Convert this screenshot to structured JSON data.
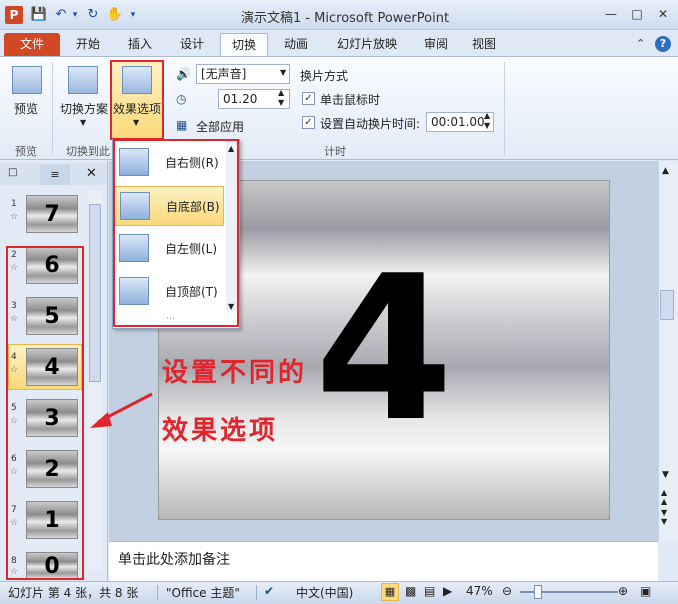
{
  "window": {
    "title": "演示文稿1 - Microsoft PowerPoint",
    "app_icon_letter": "P"
  },
  "quick_access": {
    "save_icon": "save-icon",
    "undo_icon": "undo-icon",
    "redo_icon": "redo-icon",
    "touch_icon": "touch-icon"
  },
  "tabs": [
    "文件",
    "开始",
    "插入",
    "设计",
    "切换",
    "动画",
    "幻灯片放映",
    "审阅",
    "视图"
  ],
  "active_tab": "切换",
  "ribbon": {
    "preview_label": "预览",
    "transition_scheme_label": "切换方案",
    "effect_options_label": "效果选项",
    "group_preview": "预览",
    "group_transition": "切换到此",
    "sound_value": "[无声音]",
    "duration_value": "01.20",
    "apply_all_label": "全部应用",
    "advance_heading": "换片方式",
    "on_click_label": "单击鼠标时",
    "on_click_checked": true,
    "after_label": "设置自动换片时间:",
    "after_checked": true,
    "after_value": "00:01.00",
    "timing_group": "计时"
  },
  "slides": [
    {
      "num": "1",
      "digit": "7"
    },
    {
      "num": "2",
      "digit": "6"
    },
    {
      "num": "3",
      "digit": "5"
    },
    {
      "num": "4",
      "digit": "4",
      "selected": true
    },
    {
      "num": "5",
      "digit": "3"
    },
    {
      "num": "6",
      "digit": "2"
    },
    {
      "num": "7",
      "digit": "1"
    },
    {
      "num": "8",
      "digit": "0"
    }
  ],
  "current_slide_digit": "4",
  "notes_placeholder": "单击此处添加备注",
  "dropdown": {
    "items": [
      {
        "label": "自右侧(R)"
      },
      {
        "label": "自底部(B)",
        "selected": true
      },
      {
        "label": "自左侧(L)"
      },
      {
        "label": "自顶部(T)"
      }
    ]
  },
  "annotation": {
    "line1": "设置不同的",
    "line2": "效果选项",
    "color": "#e0262c"
  },
  "status": {
    "slide_info": "幻灯片 第 4 张，共 8 张",
    "theme": "\"Office 主题\"",
    "language": "中文(中国)",
    "zoom": "47%"
  },
  "colors": {
    "file_tab": "#d24726",
    "ribbon_bg": "#e2ebf7",
    "highlight": "#fbd97c"
  }
}
